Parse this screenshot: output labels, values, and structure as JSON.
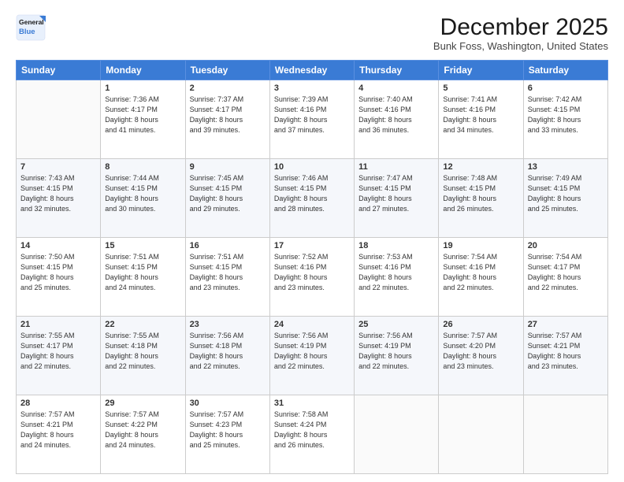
{
  "header": {
    "logo_line1": "General",
    "logo_line2": "Blue",
    "title": "December 2025",
    "subtitle": "Bunk Foss, Washington, United States"
  },
  "days_of_week": [
    "Sunday",
    "Monday",
    "Tuesday",
    "Wednesday",
    "Thursday",
    "Friday",
    "Saturday"
  ],
  "weeks": [
    [
      {
        "day": "",
        "info": ""
      },
      {
        "day": "1",
        "info": "Sunrise: 7:36 AM\nSunset: 4:17 PM\nDaylight: 8 hours\nand 41 minutes."
      },
      {
        "day": "2",
        "info": "Sunrise: 7:37 AM\nSunset: 4:17 PM\nDaylight: 8 hours\nand 39 minutes."
      },
      {
        "day": "3",
        "info": "Sunrise: 7:39 AM\nSunset: 4:16 PM\nDaylight: 8 hours\nand 37 minutes."
      },
      {
        "day": "4",
        "info": "Sunrise: 7:40 AM\nSunset: 4:16 PM\nDaylight: 8 hours\nand 36 minutes."
      },
      {
        "day": "5",
        "info": "Sunrise: 7:41 AM\nSunset: 4:16 PM\nDaylight: 8 hours\nand 34 minutes."
      },
      {
        "day": "6",
        "info": "Sunrise: 7:42 AM\nSunset: 4:15 PM\nDaylight: 8 hours\nand 33 minutes."
      }
    ],
    [
      {
        "day": "7",
        "info": "Sunrise: 7:43 AM\nSunset: 4:15 PM\nDaylight: 8 hours\nand 32 minutes."
      },
      {
        "day": "8",
        "info": "Sunrise: 7:44 AM\nSunset: 4:15 PM\nDaylight: 8 hours\nand 30 minutes."
      },
      {
        "day": "9",
        "info": "Sunrise: 7:45 AM\nSunset: 4:15 PM\nDaylight: 8 hours\nand 29 minutes."
      },
      {
        "day": "10",
        "info": "Sunrise: 7:46 AM\nSunset: 4:15 PM\nDaylight: 8 hours\nand 28 minutes."
      },
      {
        "day": "11",
        "info": "Sunrise: 7:47 AM\nSunset: 4:15 PM\nDaylight: 8 hours\nand 27 minutes."
      },
      {
        "day": "12",
        "info": "Sunrise: 7:48 AM\nSunset: 4:15 PM\nDaylight: 8 hours\nand 26 minutes."
      },
      {
        "day": "13",
        "info": "Sunrise: 7:49 AM\nSunset: 4:15 PM\nDaylight: 8 hours\nand 25 minutes."
      }
    ],
    [
      {
        "day": "14",
        "info": "Sunrise: 7:50 AM\nSunset: 4:15 PM\nDaylight: 8 hours\nand 25 minutes."
      },
      {
        "day": "15",
        "info": "Sunrise: 7:51 AM\nSunset: 4:15 PM\nDaylight: 8 hours\nand 24 minutes."
      },
      {
        "day": "16",
        "info": "Sunrise: 7:51 AM\nSunset: 4:15 PM\nDaylight: 8 hours\nand 23 minutes."
      },
      {
        "day": "17",
        "info": "Sunrise: 7:52 AM\nSunset: 4:16 PM\nDaylight: 8 hours\nand 23 minutes."
      },
      {
        "day": "18",
        "info": "Sunrise: 7:53 AM\nSunset: 4:16 PM\nDaylight: 8 hours\nand 22 minutes."
      },
      {
        "day": "19",
        "info": "Sunrise: 7:54 AM\nSunset: 4:16 PM\nDaylight: 8 hours\nand 22 minutes."
      },
      {
        "day": "20",
        "info": "Sunrise: 7:54 AM\nSunset: 4:17 PM\nDaylight: 8 hours\nand 22 minutes."
      }
    ],
    [
      {
        "day": "21",
        "info": "Sunrise: 7:55 AM\nSunset: 4:17 PM\nDaylight: 8 hours\nand 22 minutes."
      },
      {
        "day": "22",
        "info": "Sunrise: 7:55 AM\nSunset: 4:18 PM\nDaylight: 8 hours\nand 22 minutes."
      },
      {
        "day": "23",
        "info": "Sunrise: 7:56 AM\nSunset: 4:18 PM\nDaylight: 8 hours\nand 22 minutes."
      },
      {
        "day": "24",
        "info": "Sunrise: 7:56 AM\nSunset: 4:19 PM\nDaylight: 8 hours\nand 22 minutes."
      },
      {
        "day": "25",
        "info": "Sunrise: 7:56 AM\nSunset: 4:19 PM\nDaylight: 8 hours\nand 22 minutes."
      },
      {
        "day": "26",
        "info": "Sunrise: 7:57 AM\nSunset: 4:20 PM\nDaylight: 8 hours\nand 23 minutes."
      },
      {
        "day": "27",
        "info": "Sunrise: 7:57 AM\nSunset: 4:21 PM\nDaylight: 8 hours\nand 23 minutes."
      }
    ],
    [
      {
        "day": "28",
        "info": "Sunrise: 7:57 AM\nSunset: 4:21 PM\nDaylight: 8 hours\nand 24 minutes."
      },
      {
        "day": "29",
        "info": "Sunrise: 7:57 AM\nSunset: 4:22 PM\nDaylight: 8 hours\nand 24 minutes."
      },
      {
        "day": "30",
        "info": "Sunrise: 7:57 AM\nSunset: 4:23 PM\nDaylight: 8 hours\nand 25 minutes."
      },
      {
        "day": "31",
        "info": "Sunrise: 7:58 AM\nSunset: 4:24 PM\nDaylight: 8 hours\nand 26 minutes."
      },
      {
        "day": "",
        "info": ""
      },
      {
        "day": "",
        "info": ""
      },
      {
        "day": "",
        "info": ""
      }
    ]
  ]
}
